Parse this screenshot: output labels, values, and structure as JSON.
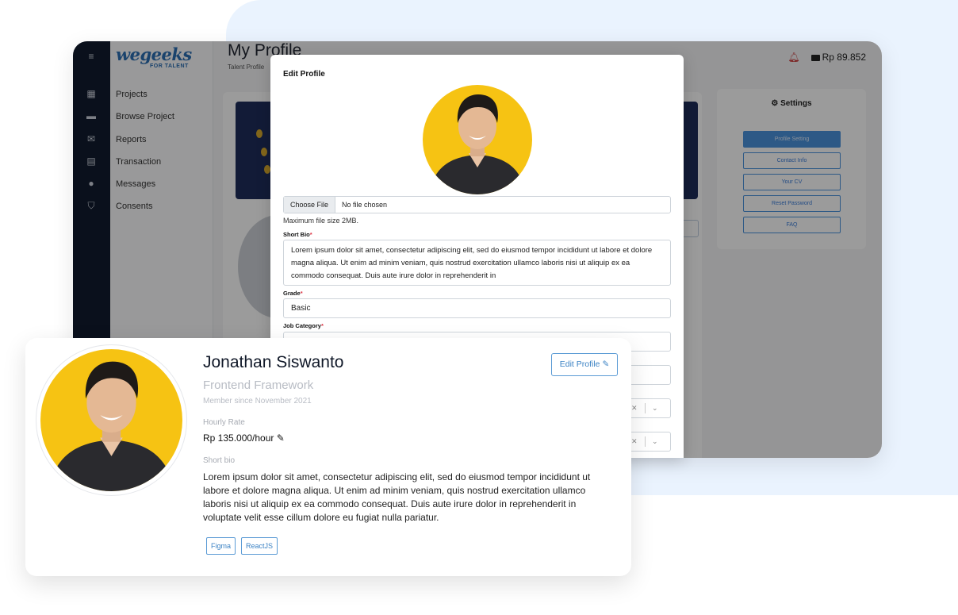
{
  "app": {
    "logo": "wegeeks",
    "logo_sub": "FOR TALENT",
    "page_title": "My Profile",
    "page_subtitle": "Talent Profile",
    "balance": "Rp 89.852"
  },
  "sidebar": {
    "items": [
      {
        "label": "Projects",
        "icon": "grid-icon"
      },
      {
        "label": "Browse Project",
        "icon": "folder-icon"
      },
      {
        "label": "Reports",
        "icon": "mail-icon"
      },
      {
        "label": "Transaction",
        "icon": "receipt-icon"
      },
      {
        "label": "Messages",
        "icon": "chat-icon"
      },
      {
        "label": "Consents",
        "icon": "shield-icon"
      }
    ]
  },
  "settings": {
    "title": "Settings",
    "buttons": [
      "Profile Setting",
      "Contact Info",
      "Your CV",
      "Reset Password",
      "FAQ"
    ]
  },
  "modal": {
    "title": "Edit Profile",
    "file_button": "Choose File",
    "file_status": "No file chosen",
    "file_hint": "Maximum file size 2MB.",
    "short_bio_label": "Short Bio",
    "short_bio_value": "Lorem ipsum dolor sit amet, consectetur adipiscing elit, sed do eiusmod tempor incididunt ut labore et dolore magna aliqua. Ut enim ad minim veniam, quis nostrud exercitation ullamco laboris nisi ut aliquip ex ea commodo consequat. Duis aute irure dolor in reprehenderit in",
    "grade_label": "Grade",
    "grade_value": "Basic",
    "job_category_label": "Job Category",
    "required_mark": "*"
  },
  "profile": {
    "name": "Jonathan Siswanto",
    "role": "Frontend Framework",
    "member_since": "Member since November 2021",
    "hourly_rate_label": "Hourly Rate",
    "hourly_rate_value": "Rp 135.000/hour",
    "short_bio_label": "Short bio",
    "short_bio_value": "Lorem ipsum dolor sit amet, consectetur adipiscing elit, sed do eiusmod tempor incididunt ut labore et dolore magna aliqua. Ut enim ad minim veniam, quis nostrud exercitation ullamco laboris nisi ut aliquip ex ea commodo consequat. Duis aute irure dolor in reprehenderit in voluptate velit esse cillum dolore eu fugiat nulla pariatur.",
    "edit_button": "Edit Profile",
    "tags": [
      "Figma",
      "ReactJS"
    ]
  },
  "colors": {
    "accent": "#3b82c4",
    "photo_bg": "#f6c313",
    "rail": "#111b2e"
  }
}
